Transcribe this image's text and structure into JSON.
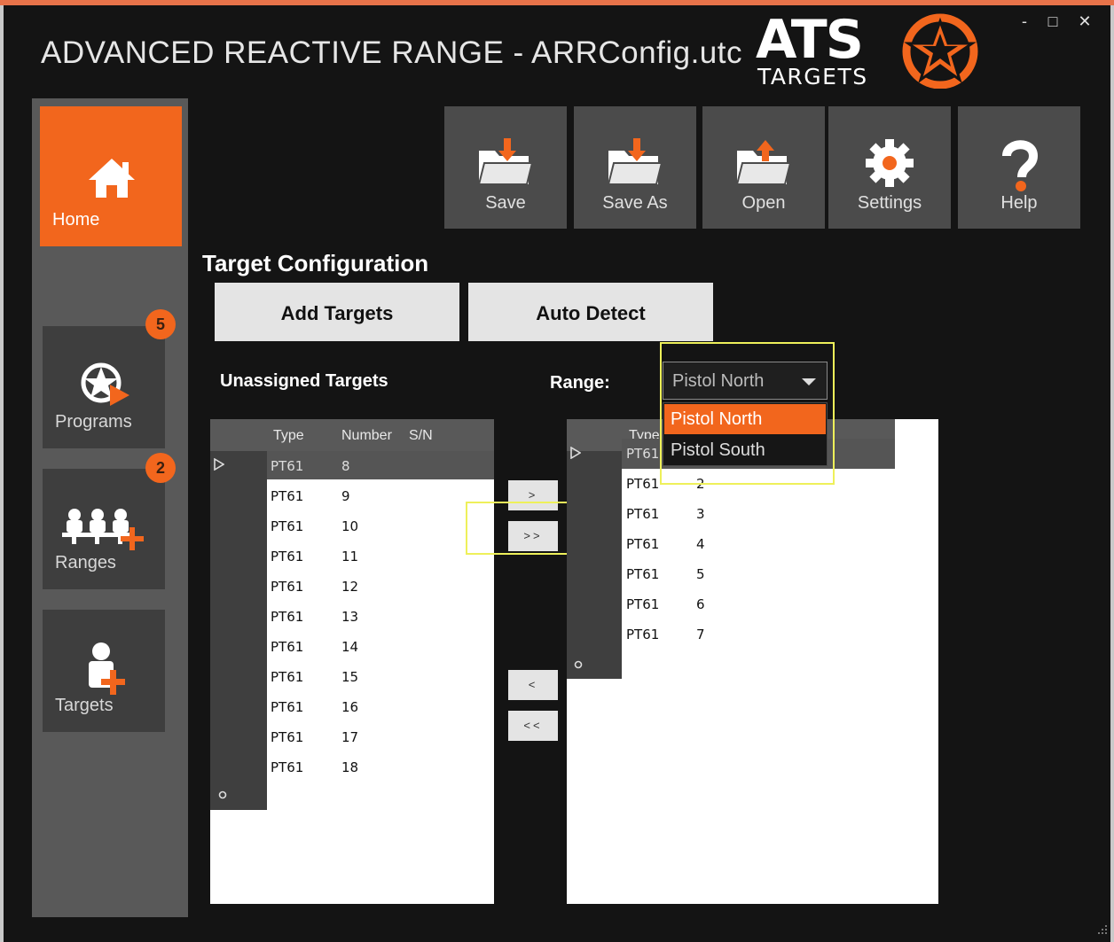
{
  "window": {
    "title": "ADVANCED REACTIVE RANGE - ARRConfig.utc",
    "controls": {
      "minimize": "-",
      "maximize": "□",
      "close": "✕"
    }
  },
  "logo": {
    "main": "ATS",
    "sub": "TARGETS"
  },
  "sidebar": {
    "items": [
      {
        "label": "Home",
        "icon": "home-icon",
        "active": true
      },
      {
        "label": "Programs",
        "icon": "programs-icon",
        "badge": "5"
      },
      {
        "label": "Ranges",
        "icon": "ranges-icon",
        "badge": "2"
      },
      {
        "label": "Targets",
        "icon": "targets-icon"
      }
    ]
  },
  "toolbar": {
    "save": "Save",
    "save_as": "Save As",
    "open": "Open",
    "settings": "Settings",
    "help": "Help"
  },
  "config": {
    "title": "Target Configuration",
    "add_targets": "Add Targets",
    "auto_detect": "Auto Detect",
    "unassigned_label": "Unassigned Targets",
    "range_label": "Range:"
  },
  "unassigned_table": {
    "columns": [
      "Type",
      "Number",
      "S/N"
    ],
    "rows": [
      {
        "type": "PT61",
        "number": "8"
      },
      {
        "type": "PT61",
        "number": "9"
      },
      {
        "type": "PT61",
        "number": "10"
      },
      {
        "type": "PT61",
        "number": "11"
      },
      {
        "type": "PT61",
        "number": "12"
      },
      {
        "type": "PT61",
        "number": "13"
      },
      {
        "type": "PT61",
        "number": "14"
      },
      {
        "type": "PT61",
        "number": "15"
      },
      {
        "type": "PT61",
        "number": "16"
      },
      {
        "type": "PT61",
        "number": "17"
      },
      {
        "type": "PT61",
        "number": "18"
      }
    ]
  },
  "transfer": {
    "move_one": ">",
    "move_all": ">>",
    "back_one": "<",
    "back_all": "<<"
  },
  "range_select": {
    "value": "Pistol North",
    "options": [
      "Pistol North",
      "Pistol South"
    ]
  },
  "assigned_table": {
    "columns": [
      "Type"
    ],
    "rows": [
      {
        "type": "PT61",
        "number": ""
      },
      {
        "type": "PT61",
        "number": "2"
      },
      {
        "type": "PT61",
        "number": "3"
      },
      {
        "type": "PT61",
        "number": "4"
      },
      {
        "type": "PT61",
        "number": "5"
      },
      {
        "type": "PT61",
        "number": "6"
      },
      {
        "type": "PT61",
        "number": "7"
      }
    ]
  },
  "colors": {
    "accent": "#f2661d",
    "background": "#141414",
    "highlight": "#eef05a"
  }
}
